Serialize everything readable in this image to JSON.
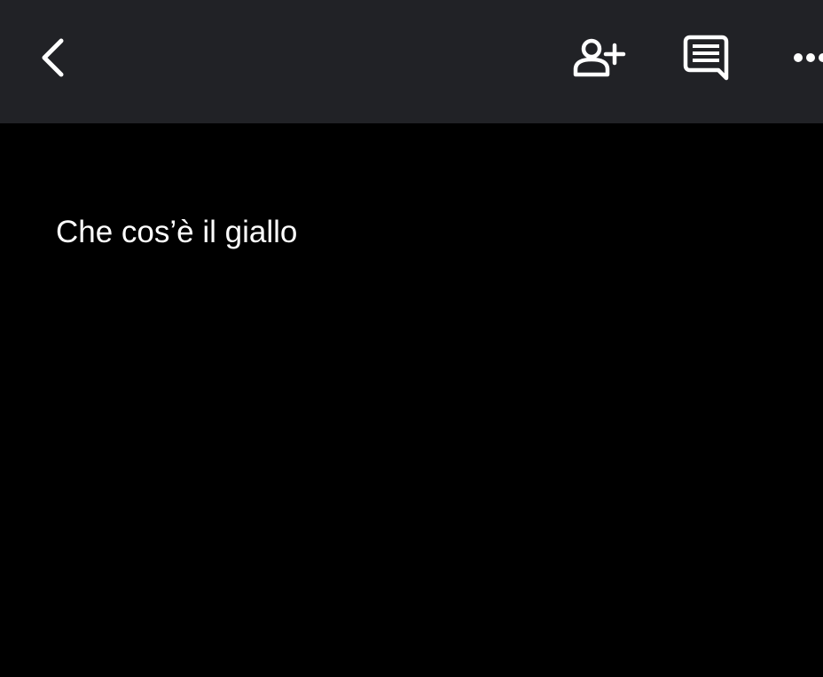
{
  "toolbar": {
    "background": "#212226",
    "icon_color": "#ffffff",
    "back_icon": "chevron-left-icon",
    "share_icon": "person-add-icon",
    "comment_icon": "comment-icon",
    "more_icon": "more-horizontal-icon"
  },
  "document": {
    "background": "#000000",
    "text_color": "#ffffff",
    "line": "Che cos’è il giallo"
  }
}
